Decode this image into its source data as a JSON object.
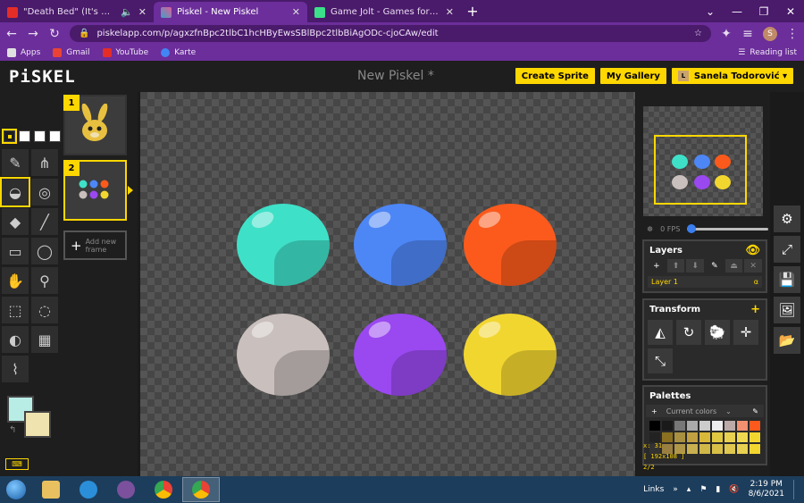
{
  "browser": {
    "tabs": [
      {
        "title": "\"Death Bed\" (It's Been So Lon",
        "favicon_color": "#e52d27",
        "active": false,
        "audio": true
      },
      {
        "title": "Piskel - New Piskel",
        "favicon_color": "#3fa0c6",
        "active": true,
        "audio": false
      },
      {
        "title": "Game Jolt - Games for the love o",
        "favicon_color": "#3ce08a",
        "active": false,
        "audio": false
      }
    ],
    "url": "piskelapp.com/p/agxzfnBpc2tlbC1hcHByEwsSBlBpc2tlbBiAgODc-cjoCAw/edit",
    "profile_initial": "S",
    "bookmarks": [
      {
        "label": "Apps",
        "color": "#e0e0e0"
      },
      {
        "label": "Gmail",
        "color": "#ea4335"
      },
      {
        "label": "YouTube",
        "color": "#e52d27"
      },
      {
        "label": "Karte",
        "color": "#4285f4"
      }
    ],
    "reading_list": "Reading list"
  },
  "app": {
    "logo": "PiSKEL",
    "title": "New Piskel *",
    "buttons": {
      "create": "Create Sprite",
      "gallery": "My Gallery"
    },
    "user": {
      "name": "Sanela Todorović ▾",
      "avatar_initial": "L"
    }
  },
  "frames": [
    {
      "number": "1",
      "active": false
    },
    {
      "number": "2",
      "active": true
    }
  ],
  "add_frame": "Add new frame",
  "canvas_balls": [
    {
      "color": "#3fe0c8",
      "row": 0,
      "col": 0
    },
    {
      "color": "#4d86f5",
      "row": 0,
      "col": 1
    },
    {
      "color": "#fb5a1c",
      "row": 0,
      "col": 2
    },
    {
      "color": "#c9bfbc",
      "row": 1,
      "col": 0
    },
    {
      "color": "#9a48f0",
      "row": 1,
      "col": 1
    },
    {
      "color": "#f2d630",
      "row": 1,
      "col": 2
    }
  ],
  "preview": {
    "fps": "0 FPS",
    "fps_value": 0
  },
  "layers": {
    "title": "Layers",
    "items": [
      {
        "name": "Layer 1",
        "alpha": "α"
      }
    ]
  },
  "transform": {
    "title": "Transform"
  },
  "palettes": {
    "title": "Palettes",
    "current": "Current colors",
    "swatches": [
      "#000000",
      "#1a1a1a",
      "#777777",
      "#aaaaaa",
      "#cccccc",
      "#eeeeee",
      "#bbaaa8",
      "#f39070",
      "#fb5a1c",
      "#222222",
      "#8a7020",
      "#a89040",
      "#c0a040",
      "#d8b838",
      "#e0c840",
      "#e8d050",
      "#f0d850",
      "#f2d630",
      "#333333",
      "#9a8040",
      "#b09848",
      "#c8b050",
      "#d0b848",
      "#d8c048",
      "#e0c850",
      "#e8d050",
      "#f2d630"
    ]
  },
  "coords": {
    "position": "x: 31",
    "size": "[ 192x108 ]",
    "frame": "2/2"
  },
  "colors": {
    "primary": "#b8ede6",
    "secondary": "#efe3b0",
    "accent": "#ffd700"
  },
  "taskbar": {
    "links": "Links",
    "time": "2:19 PM",
    "date": "8/6/2021"
  }
}
